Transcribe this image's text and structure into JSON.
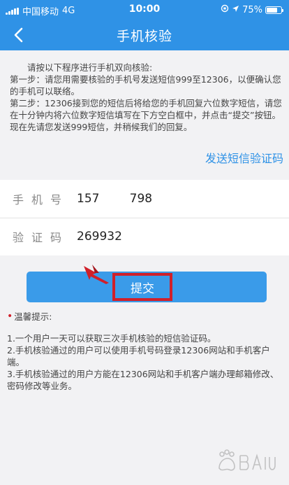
{
  "status_bar": {
    "carrier": "中国移动",
    "network": "4G",
    "time": "10:00",
    "battery": "75%",
    "battery_level": 0.75
  },
  "nav": {
    "title": "手机核验"
  },
  "instructions": {
    "intro": "请按以下程序进行手机双向核验:",
    "step1": "第一步：请您用需要核验的手机号发送短信999至12306，以便确认您的手机可以联络。",
    "step2": "第二步：12306接到您的短信后将给您的手机回复六位数字短信，请您在十分钟内将六位数字短信填写在下方空白框中，并点击“提交”按钮。现在先请您发送999短信，并稍候我们的回复。"
  },
  "send_code_label": "发送短信验证码",
  "form": {
    "phone_label": "手机号",
    "phone_value": "157        798",
    "code_label": "验证码",
    "code_value": "269932"
  },
  "submit_label": "提交",
  "tips": {
    "title": "温馨提示:",
    "items": [
      "1.一个用户一天可以获取三次手机核验的短信验证码。",
      "2.手机核验通过的用户可以使用手机号码登录12306网站和手机客户端。",
      "3.手机核验通过的用户方能在12306网站和手机客户端办理邮箱修改、密码修改等业务。"
    ]
  },
  "colors": {
    "primary": "#2f92e6",
    "highlight": "#d0202a"
  }
}
